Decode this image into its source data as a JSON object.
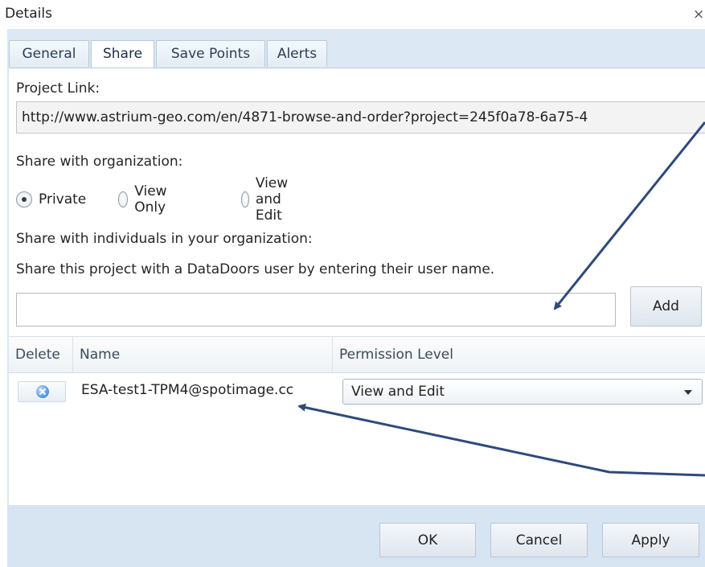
{
  "window": {
    "title": "Details",
    "close_glyph": "×"
  },
  "tabs": [
    {
      "label": "General"
    },
    {
      "label": "Share"
    },
    {
      "label": "Save Points"
    },
    {
      "label": "Alerts"
    }
  ],
  "share": {
    "project_link_label": "Project Link:",
    "project_link_value": "http://www.astrium-geo.com/en/4871-browse-and-order?project=245f0a78-6a75-4",
    "org_label": "Share with organization:",
    "radios": [
      {
        "label": "Private",
        "checked": true
      },
      {
        "label": "View Only",
        "checked": false
      },
      {
        "label": "View and Edit",
        "checked": false
      }
    ],
    "individuals_label": "Share with individuals in your organization:",
    "instruction": "Share this project with a DataDoors user by entering their user name.",
    "user_input_value": "",
    "add_label": "Add"
  },
  "grid": {
    "columns": [
      "Delete",
      "Name",
      "Permission Level"
    ],
    "rows": [
      {
        "name": "ESA-test1-TPM4@spotimage.cc",
        "permission": "View and Edit"
      }
    ]
  },
  "footer": {
    "ok_label": "OK",
    "cancel_label": "Cancel",
    "apply_label": "Apply"
  },
  "annotation": {
    "arrow_color": "#2e4a7c"
  },
  "icons": {
    "delete": "delete-x-icon",
    "dropdown": "chevron-down-icon",
    "close": "close-icon"
  }
}
